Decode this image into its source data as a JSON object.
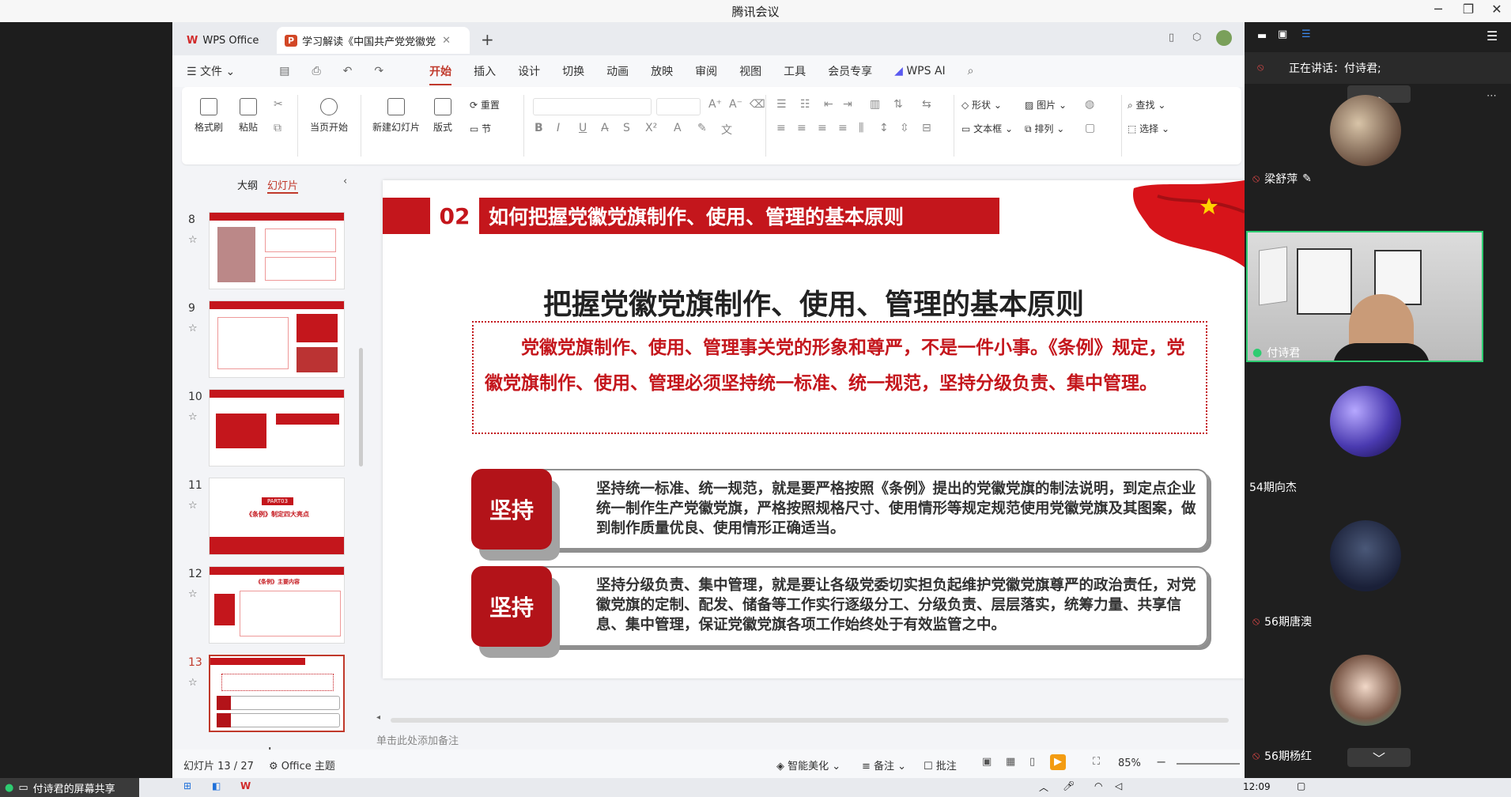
{
  "window": {
    "title": "腾讯会议"
  },
  "tabs": [
    {
      "label": "WPS Office"
    },
    {
      "label": "学习解读《中国共产党党徽党"
    }
  ],
  "menu": {
    "file": "文件",
    "items": [
      "开始",
      "插入",
      "设计",
      "切换",
      "动画",
      "放映",
      "审阅",
      "视图",
      "工具",
      "会员专享"
    ],
    "ai": "WPS AI"
  },
  "ribbon": {
    "format_painter": "格式刷",
    "paste": "粘贴",
    "start_from": "当页开始",
    "new_slide": "新建幻灯片",
    "layout": "版式",
    "section": "节",
    "reset": "重置",
    "shape": "形状",
    "picture": "图片",
    "textbox": "文本框",
    "arrange": "排列",
    "find": "查找",
    "select": "选择"
  },
  "panel": {
    "outline": "大纲",
    "slides": "幻灯片",
    "numbers": [
      "8",
      "9",
      "10",
      "11",
      "12",
      "13"
    ],
    "thumb11_part": "PART03",
    "thumb11_title": "《条例》制定四大亮点",
    "thumb12_title": "《条例》主要内容"
  },
  "slide": {
    "section_num": "02",
    "header": "如何把握党徽党旗制作、使用、管理的基本原则",
    "title": "把握党徽党旗制作、使用、管理的基本原则",
    "intro": "党徽党旗制作、使用、管理事关党的形象和尊严，不是一件小事。《条例》规定，党徽党旗制作、使用、管理必须坚持统一标准、统一规范，坚持分级负责、集中管理。",
    "card1_label": "坚持",
    "card1_text": "坚持统一标准、统一规范，就是要严格按照《条例》提出的党徽党旗的制法说明，到定点企业统一制作生产党徽党旗，严格按照规格尺寸、使用情形等规定规范使用党徽党旗及其图案，做到制作质量优良、使用情形正确适当。",
    "card2_label": "坚持",
    "card2_text": "坚持分级负责、集中管理，就是要让各级党委切实担负起维护党徽党旗尊严的政治责任，对党徽党旗的定制、配发、储备等工作实行逐级分工、分级负责、层层落实，统筹力量、共享信息、集中管理，保证党徽党旗各项工作始终处于有效监管之中。"
  },
  "notes_placeholder": "单击此处添加备注",
  "status": {
    "slide_pos": "幻灯片 13 / 27",
    "theme": "Office 主题",
    "beautify": "智能美化",
    "notes": "备注",
    "comments": "批注",
    "zoom": "85%"
  },
  "meeting": {
    "speaking": "正在讲话：付诗君;",
    "participants": [
      "梁舒萍",
      "付诗君",
      "54期向杰",
      "56期唐澳",
      "56期杨红"
    ]
  },
  "screenshare": "付诗君的屏幕共享",
  "taskbar": {
    "time": "12:09"
  },
  "colors": {
    "accent": "#c4161c",
    "active_speaker": "#2ecc71"
  }
}
